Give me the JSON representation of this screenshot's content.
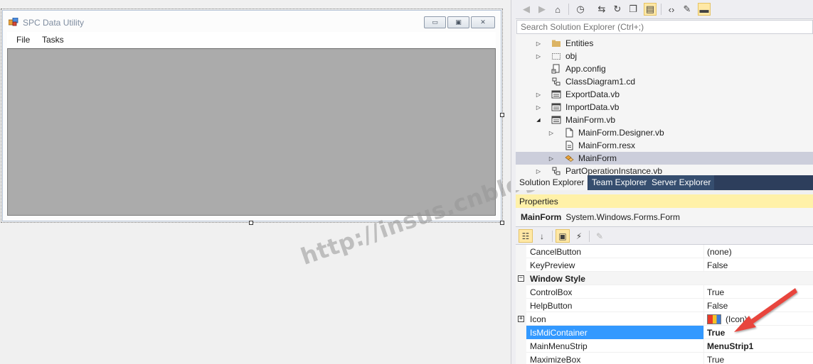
{
  "form": {
    "title": "SPC Data Utility",
    "menu": [
      "File",
      "Tasks"
    ],
    "caption_buttons": {
      "minimize": "▭",
      "maximize": "▣",
      "close": "✕"
    }
  },
  "watermark": "http://insus.cnblogs.com",
  "solution_explorer": {
    "search_placeholder": "Search Solution Explorer (Ctrl+;)",
    "toolbar_icons": [
      "back-icon",
      "forward-icon",
      "home-icon",
      "history-icon",
      "sync-icon",
      "refresh-icon",
      "collapse-all-icon",
      "show-all-files-icon",
      "view-code-icon",
      "properties-wrench-icon",
      "preview-icon"
    ],
    "tree": [
      {
        "label": "Entities",
        "icon": "folder-icon",
        "level": 1,
        "expander": "collapsed",
        "selected": false
      },
      {
        "label": "obj",
        "icon": "hidden-folder-icon",
        "level": 1,
        "expander": "collapsed",
        "selected": false
      },
      {
        "label": "App.config",
        "icon": "config-file-icon",
        "level": 1,
        "expander": "none",
        "selected": false
      },
      {
        "label": "ClassDiagram1.cd",
        "icon": "class-diagram-icon",
        "level": 1,
        "expander": "none",
        "selected": false
      },
      {
        "label": "ExportData.vb",
        "icon": "form-file-icon",
        "level": 1,
        "expander": "collapsed",
        "selected": false
      },
      {
        "label": "ImportData.vb",
        "icon": "form-file-icon",
        "level": 1,
        "expander": "collapsed",
        "selected": false
      },
      {
        "label": "MainForm.vb",
        "icon": "form-file-icon",
        "level": 1,
        "expander": "expanded",
        "selected": false
      },
      {
        "label": "MainForm.Designer.vb",
        "icon": "vb-file-icon",
        "level": 2,
        "expander": "collapsed",
        "selected": false
      },
      {
        "label": "MainForm.resx",
        "icon": "resx-file-icon",
        "level": 2,
        "expander": "none",
        "selected": false
      },
      {
        "label": "MainForm",
        "icon": "class-icon",
        "level": 2,
        "expander": "collapsed",
        "selected": true
      },
      {
        "label": "PartOperationInstance.vb",
        "icon": "class-diagram-icon",
        "level": 1,
        "expander": "collapsed",
        "selected": false
      }
    ],
    "tabs": [
      {
        "label": "Solution Explorer",
        "active": true
      },
      {
        "label": "Team Explorer",
        "active": false
      },
      {
        "label": "Server Explorer",
        "active": false
      }
    ]
  },
  "properties": {
    "header": "Properties",
    "object_name": "MainForm",
    "object_type": "System.Windows.Forms.Form",
    "rows": [
      {
        "kind": "property",
        "name": "CancelButton",
        "value": "(none)",
        "bold": false,
        "selected": false,
        "expandable": false
      },
      {
        "kind": "property",
        "name": "KeyPreview",
        "value": "False",
        "bold": false,
        "selected": false,
        "expandable": false
      },
      {
        "kind": "category",
        "name": "Window Style",
        "value": "",
        "bold": true,
        "selected": false,
        "expandable": true
      },
      {
        "kind": "property",
        "name": "ControlBox",
        "value": "True",
        "bold": false,
        "selected": false,
        "expandable": false
      },
      {
        "kind": "property",
        "name": "HelpButton",
        "value": "False",
        "bold": false,
        "selected": false,
        "expandable": false
      },
      {
        "kind": "property",
        "name": "Icon",
        "value": "(Icon)",
        "bold": false,
        "selected": false,
        "expandable": true
      },
      {
        "kind": "property",
        "name": "IsMdiContainer",
        "value": "True",
        "bold": true,
        "selected": true,
        "expandable": false
      },
      {
        "kind": "property",
        "name": "MainMenuStrip",
        "value": "MenuStrip1",
        "bold": true,
        "selected": false,
        "expandable": false
      },
      {
        "kind": "property",
        "name": "MaximizeBox",
        "value": "True",
        "bold": false,
        "selected": false,
        "expandable": false
      }
    ]
  },
  "colors": {
    "accent_selection": "#3399ff",
    "tree_selection": "#cccedb",
    "properties_header": "#fff1a8",
    "tab_bar": "#2d3e5c",
    "annotation_arrow": "#e8453c",
    "mdi_background": "#ababab"
  }
}
